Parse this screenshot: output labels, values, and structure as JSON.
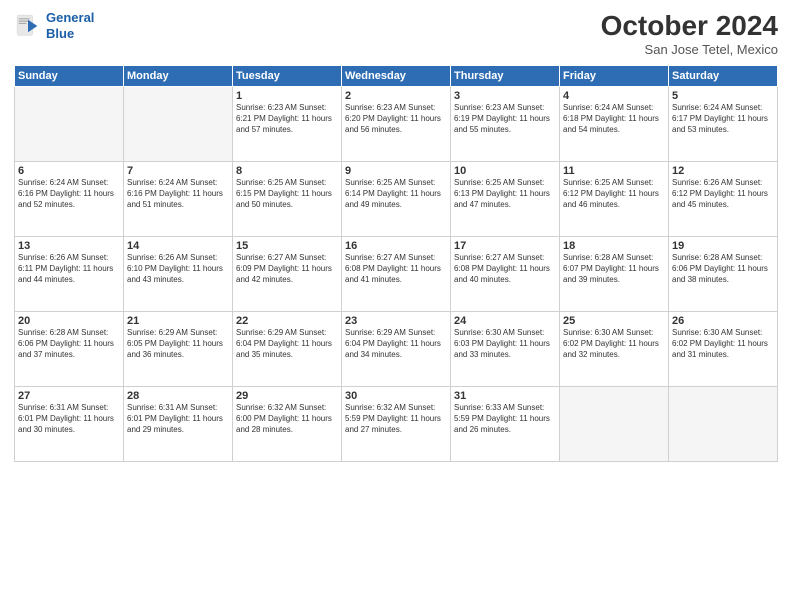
{
  "header": {
    "logo_line1": "General",
    "logo_line2": "Blue",
    "month": "October 2024",
    "location": "San Jose Tetel, Mexico"
  },
  "days_of_week": [
    "Sunday",
    "Monday",
    "Tuesday",
    "Wednesday",
    "Thursday",
    "Friday",
    "Saturday"
  ],
  "weeks": [
    [
      {
        "num": "",
        "info": ""
      },
      {
        "num": "",
        "info": ""
      },
      {
        "num": "1",
        "info": "Sunrise: 6:23 AM\nSunset: 6:21 PM\nDaylight: 11 hours and 57 minutes."
      },
      {
        "num": "2",
        "info": "Sunrise: 6:23 AM\nSunset: 6:20 PM\nDaylight: 11 hours and 56 minutes."
      },
      {
        "num": "3",
        "info": "Sunrise: 6:23 AM\nSunset: 6:19 PM\nDaylight: 11 hours and 55 minutes."
      },
      {
        "num": "4",
        "info": "Sunrise: 6:24 AM\nSunset: 6:18 PM\nDaylight: 11 hours and 54 minutes."
      },
      {
        "num": "5",
        "info": "Sunrise: 6:24 AM\nSunset: 6:17 PM\nDaylight: 11 hours and 53 minutes."
      }
    ],
    [
      {
        "num": "6",
        "info": "Sunrise: 6:24 AM\nSunset: 6:16 PM\nDaylight: 11 hours and 52 minutes."
      },
      {
        "num": "7",
        "info": "Sunrise: 6:24 AM\nSunset: 6:16 PM\nDaylight: 11 hours and 51 minutes."
      },
      {
        "num": "8",
        "info": "Sunrise: 6:25 AM\nSunset: 6:15 PM\nDaylight: 11 hours and 50 minutes."
      },
      {
        "num": "9",
        "info": "Sunrise: 6:25 AM\nSunset: 6:14 PM\nDaylight: 11 hours and 49 minutes."
      },
      {
        "num": "10",
        "info": "Sunrise: 6:25 AM\nSunset: 6:13 PM\nDaylight: 11 hours and 47 minutes."
      },
      {
        "num": "11",
        "info": "Sunrise: 6:25 AM\nSunset: 6:12 PM\nDaylight: 11 hours and 46 minutes."
      },
      {
        "num": "12",
        "info": "Sunrise: 6:26 AM\nSunset: 6:12 PM\nDaylight: 11 hours and 45 minutes."
      }
    ],
    [
      {
        "num": "13",
        "info": "Sunrise: 6:26 AM\nSunset: 6:11 PM\nDaylight: 11 hours and 44 minutes."
      },
      {
        "num": "14",
        "info": "Sunrise: 6:26 AM\nSunset: 6:10 PM\nDaylight: 11 hours and 43 minutes."
      },
      {
        "num": "15",
        "info": "Sunrise: 6:27 AM\nSunset: 6:09 PM\nDaylight: 11 hours and 42 minutes."
      },
      {
        "num": "16",
        "info": "Sunrise: 6:27 AM\nSunset: 6:08 PM\nDaylight: 11 hours and 41 minutes."
      },
      {
        "num": "17",
        "info": "Sunrise: 6:27 AM\nSunset: 6:08 PM\nDaylight: 11 hours and 40 minutes."
      },
      {
        "num": "18",
        "info": "Sunrise: 6:28 AM\nSunset: 6:07 PM\nDaylight: 11 hours and 39 minutes."
      },
      {
        "num": "19",
        "info": "Sunrise: 6:28 AM\nSunset: 6:06 PM\nDaylight: 11 hours and 38 minutes."
      }
    ],
    [
      {
        "num": "20",
        "info": "Sunrise: 6:28 AM\nSunset: 6:06 PM\nDaylight: 11 hours and 37 minutes."
      },
      {
        "num": "21",
        "info": "Sunrise: 6:29 AM\nSunset: 6:05 PM\nDaylight: 11 hours and 36 minutes."
      },
      {
        "num": "22",
        "info": "Sunrise: 6:29 AM\nSunset: 6:04 PM\nDaylight: 11 hours and 35 minutes."
      },
      {
        "num": "23",
        "info": "Sunrise: 6:29 AM\nSunset: 6:04 PM\nDaylight: 11 hours and 34 minutes."
      },
      {
        "num": "24",
        "info": "Sunrise: 6:30 AM\nSunset: 6:03 PM\nDaylight: 11 hours and 33 minutes."
      },
      {
        "num": "25",
        "info": "Sunrise: 6:30 AM\nSunset: 6:02 PM\nDaylight: 11 hours and 32 minutes."
      },
      {
        "num": "26",
        "info": "Sunrise: 6:30 AM\nSunset: 6:02 PM\nDaylight: 11 hours and 31 minutes."
      }
    ],
    [
      {
        "num": "27",
        "info": "Sunrise: 6:31 AM\nSunset: 6:01 PM\nDaylight: 11 hours and 30 minutes."
      },
      {
        "num": "28",
        "info": "Sunrise: 6:31 AM\nSunset: 6:01 PM\nDaylight: 11 hours and 29 minutes."
      },
      {
        "num": "29",
        "info": "Sunrise: 6:32 AM\nSunset: 6:00 PM\nDaylight: 11 hours and 28 minutes."
      },
      {
        "num": "30",
        "info": "Sunrise: 6:32 AM\nSunset: 5:59 PM\nDaylight: 11 hours and 27 minutes."
      },
      {
        "num": "31",
        "info": "Sunrise: 6:33 AM\nSunset: 5:59 PM\nDaylight: 11 hours and 26 minutes."
      },
      {
        "num": "",
        "info": ""
      },
      {
        "num": "",
        "info": ""
      }
    ]
  ]
}
